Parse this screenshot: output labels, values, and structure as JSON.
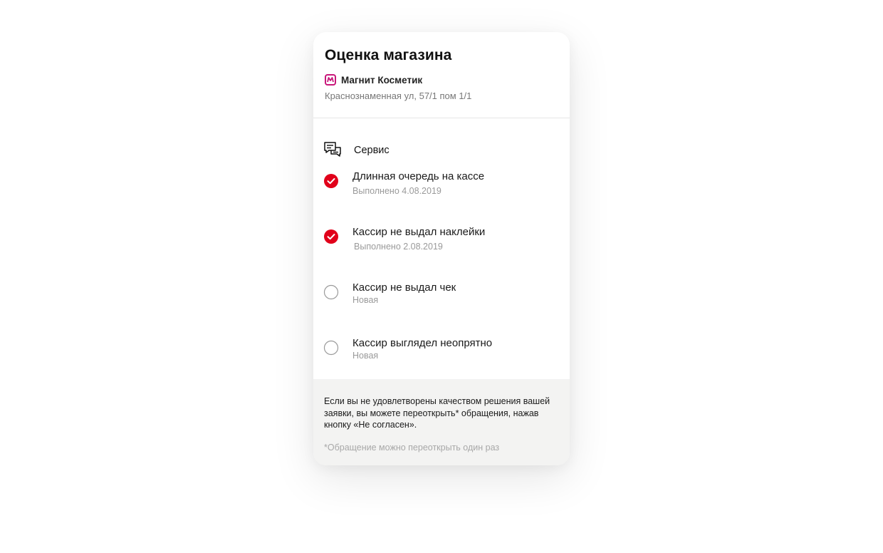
{
  "header": {
    "title": "Оценка магазина",
    "store_name": "Магнит Косметик",
    "store_address": "Краснознаменная ул, 57/1 пом 1/1",
    "logo_icon": "magnit-kosmetik-logo-icon",
    "brand_color": "#c8177a"
  },
  "section": {
    "title": "Сервис",
    "icon": "chat-bubbles-icon",
    "items": [
      {
        "title": "Длинная очередь на кассе",
        "status": "Выполнено 4.08.2019",
        "checked": true
      },
      {
        "title": "Кассир не выдал наклейки",
        "status": "Выполнено 2.08.2019",
        "checked": true
      },
      {
        "title": "Кассир не выдал чек",
        "status": "Новая",
        "checked": false
      },
      {
        "title": "Кассир выглядел неопрятно",
        "status": "Новая",
        "checked": false
      }
    ]
  },
  "footer": {
    "note": "Если вы не удовлетворены качеством решения вашей заявки, вы можете переоткрыть* обращения, нажав кнопку «Не согласен».",
    "footnote": "*Обращение можно переоткрыть один раз"
  },
  "colors": {
    "accent": "#e1001a",
    "muted_text": "#9a9a9a",
    "footer_bg": "#f3f3f2"
  }
}
